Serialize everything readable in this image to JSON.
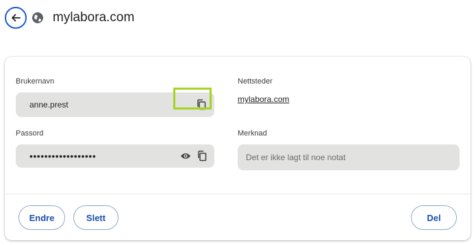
{
  "header": {
    "title": "mylabora.com"
  },
  "form": {
    "username_label": "Brukernavn",
    "username_value": "anne.prest",
    "password_label": "Passord",
    "password_value": "••••••••••••••••••",
    "websites_label": "Nettsteder",
    "website_link": "mylabora.com",
    "note_label": "Merknad",
    "note_placeholder": "Det er ikke lagt til noe notat"
  },
  "actions": {
    "edit_label": "Endre",
    "delete_label": "Slett",
    "share_label": "Del"
  },
  "colors": {
    "accent": "#1a5bd6",
    "highlight": "#a6d31f",
    "field_bg": "#e2e3e1"
  }
}
